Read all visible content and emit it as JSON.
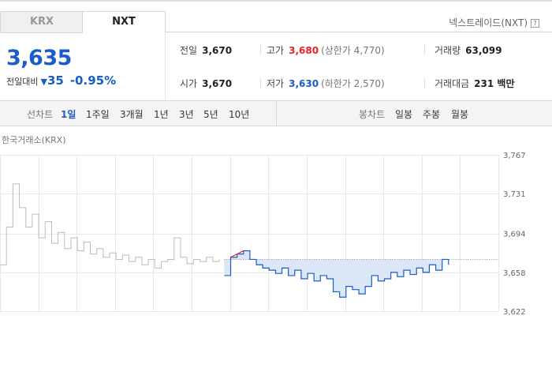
{
  "tabs": [
    {
      "label": "KRX",
      "active": false
    },
    {
      "label": "NXT",
      "active": true
    }
  ],
  "market_label": "넥스트레이드(NXT)",
  "help_icon": "?",
  "price": "3,635",
  "change_label": "전일대비",
  "change_icon": "down-triangle-icon",
  "change_value": "35",
  "change_rate": "-0.95%",
  "stats": {
    "prev": {
      "label": "전일",
      "value": "3,670"
    },
    "high": {
      "label": "고가",
      "value": "3,680",
      "limit": "(상한가 4,770)"
    },
    "volume": {
      "label": "거래량",
      "value": "63,099"
    },
    "open": {
      "label": "시가",
      "value": "3,670"
    },
    "low": {
      "label": "저가",
      "value": "3,630",
      "limit": "(하한가 2,570)"
    },
    "amount": {
      "label": "거래대금",
      "value": "231 백만"
    }
  },
  "line_chart_bar": {
    "title": "선차트",
    "periods": [
      "1일",
      "1주일",
      "3개월",
      "1년",
      "3년",
      "5년",
      "10년"
    ],
    "selected": "1일"
  },
  "candle_chart_bar": {
    "title": "봉차트",
    "periods": [
      "일봉",
      "주봉",
      "월봉"
    ]
  },
  "colors": {
    "up": "#e8212a",
    "down": "#1a5cc9",
    "krx_line": "#bbbbbb"
  },
  "chart_data": {
    "type": "line",
    "exchange_label": "한국거래소(KRX)",
    "y_ticks": [
      "3,767",
      "3,731",
      "3,694",
      "3,658",
      "3,622"
    ],
    "ylim": [
      3622,
      3767
    ],
    "baseline": 3670,
    "grid": true,
    "series": [
      {
        "name": "한국거래소(KRX)",
        "x_start": 0,
        "x_end": 0.44,
        "values": [
          3665,
          3700,
          3740,
          3718,
          3700,
          3712,
          3690,
          3705,
          3685,
          3695,
          3680,
          3690,
          3678,
          3686,
          3675,
          3680,
          3672,
          3676,
          3670,
          3674,
          3668,
          3672,
          3665,
          3670,
          3662,
          3668,
          3670,
          3690,
          3672,
          3666,
          3670,
          3668,
          3672,
          3668,
          3670
        ]
      },
      {
        "name": "넥스트레이드(NXT)",
        "x_start": 0.45,
        "x_end": 0.9,
        "values": [
          3655,
          3672,
          3675,
          3678,
          3670,
          3665,
          3662,
          3660,
          3657,
          3662,
          3655,
          3660,
          3652,
          3657,
          3650,
          3655,
          3652,
          3640,
          3635,
          3645,
          3642,
          3638,
          3645,
          3655,
          3650,
          3652,
          3658,
          3654,
          3660,
          3656,
          3662,
          3658,
          3665,
          3660,
          3670,
          3665
        ]
      }
    ]
  }
}
